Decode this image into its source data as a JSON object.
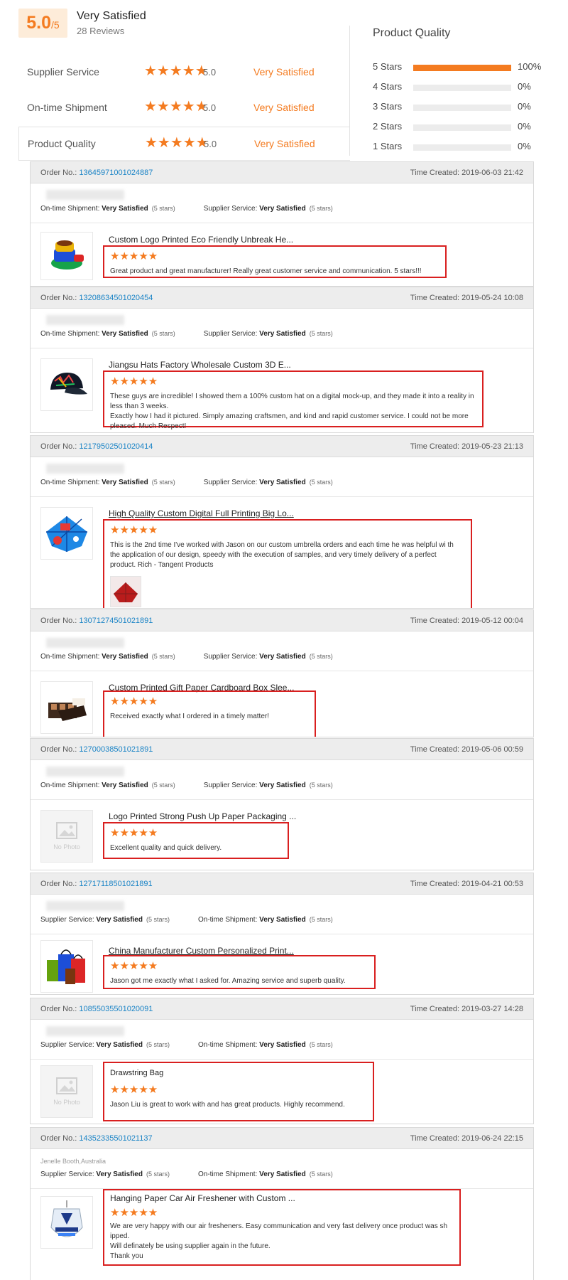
{
  "summary": {
    "score": "5.0",
    "score_max": "/5",
    "overall_label": "Very Satisfied",
    "review_count": "28 Reviews",
    "metrics": [
      {
        "label": "Supplier Service",
        "stars": "★★★★★",
        "value": "5.0",
        "text": "Very Satisfied"
      },
      {
        "label": "On-time Shipment",
        "stars": "★★★★★",
        "value": "5.0",
        "text": "Very Satisfied"
      },
      {
        "label": "Product Quality",
        "stars": "★★★★★",
        "value": "5.0",
        "text": "Very Satisfied"
      }
    ],
    "distribution_title": "Product Quality",
    "distribution": [
      {
        "label": "5 Stars",
        "percent": "100%",
        "fraction": 1.0
      },
      {
        "label": "4 Stars",
        "percent": "0%",
        "fraction": 0
      },
      {
        "label": "3 Stars",
        "percent": "0%",
        "fraction": 0
      },
      {
        "label": "2 Stars",
        "percent": "0%",
        "fraction": 0
      },
      {
        "label": "1 Stars",
        "percent": "0%",
        "fraction": 0
      }
    ],
    "accent_color": "#f47b20"
  },
  "labels": {
    "order_no": "Order No.: ",
    "time_created": "Time Created: ",
    "on_time": "On-time Shipment: ",
    "supplier": "Supplier Service: ",
    "very_satisfied": "Very Satisfied",
    "five_stars": "(5 stars)",
    "review_stars": "★★★★★",
    "no_photo": "No Photo"
  },
  "reviews": [
    {
      "order_no": "13645971001024887",
      "time": "2019-06-03 21:42",
      "buyer": "",
      "product": "Custom Logo Printed Eco Friendly Unbreak He...",
      "text": "Great product and great manufacturer! Really great customer service and communication. 5 stars!!!",
      "thumb_icon": "ashtray-product-icon"
    },
    {
      "order_no": "13208634501020454",
      "time": "2019-05-24 10:08",
      "buyer": "",
      "product": "Jiangsu Hats Factory Wholesale Custom 3D E...",
      "text": "These guys are incredible!  I showed them a 100% custom hat on a digital mock-up, and they made it into a reality in less than 3 weeks.\nExactly how I had it pictured.  Simply amazing craftsmen, and kind and rapid customer service.  I could not be more pleased.  Much Respect!",
      "thumb_icon": "cap-product-icon"
    },
    {
      "order_no": "12179502501020414",
      "time": "2019-05-23 21:13",
      "buyer": "",
      "product": "High Quality Custom Digital Full Printing Big Lo...",
      "text": "This is the 2nd time I've worked with Jason on our custom umbrella orders and each time he was helpful wi th the application of our design, speedy with the execution of samples, and very timely delivery of a perfect product. Rich - Tangent Products",
      "thumb_icon": "umbrella-product-icon"
    },
    {
      "order_no": "13071274501021891",
      "time": "2019-05-12 00:04",
      "buyer": "",
      "product": "Custom Printed Gift Paper Cardboard Box Slee...",
      "text": "Received exactly what I ordered in a timely matter!",
      "thumb_icon": "gift-box-product-icon"
    },
    {
      "order_no": "12700038501021891",
      "time": "2019-05-06 00:59",
      "buyer": "",
      "product": "Logo Printed Strong Push Up Paper Packaging ...",
      "text": "Excellent quality and quick delivery.",
      "thumb_icon": "no-photo-icon"
    },
    {
      "order_no": "12717118501021891",
      "time": "2019-04-21 00:53",
      "buyer": "",
      "product": "China Manufacturer Custom Personalized Print...",
      "text": "Jason got me exactly what I asked for. Amazing service and superb quality.",
      "thumb_icon": "shopping-bags-product-icon"
    },
    {
      "order_no": "10855035501020091",
      "time": "2019-03-27 14:28",
      "buyer": "",
      "product": "Drawstring Bag",
      "text": "Jason Liu is great to work with and has great products. Highly recommend.",
      "thumb_icon": "no-photo-icon"
    },
    {
      "order_no": "14352335501021137",
      "time": "2019-06-24 22:15",
      "buyer": "Jenelle Booth,Australia",
      "product": "Hanging Paper Car Air Freshener with Custom ...",
      "text": "We are very happy with our air fresheners.  Easy communication and very fast delivery once product was sh ipped.\nWill definately be using supplier again in the future.\nThank you",
      "thumb_icon": "air-freshener-product-icon"
    }
  ]
}
